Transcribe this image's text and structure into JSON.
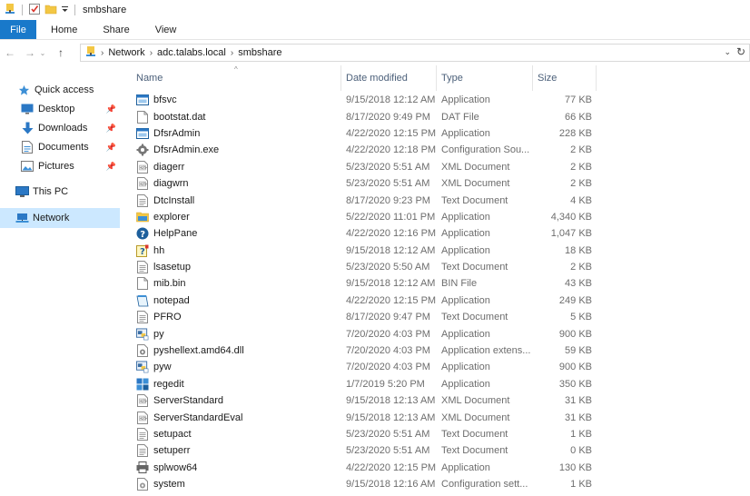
{
  "window": {
    "title": "smbshare"
  },
  "ribbon": {
    "tabs": [
      "File",
      "Home",
      "Share",
      "View"
    ]
  },
  "address": {
    "crumbs": [
      "Network",
      "adc.talabs.local",
      "smbshare"
    ]
  },
  "nav": {
    "quick_access": "Quick access",
    "desktop": "Desktop",
    "downloads": "Downloads",
    "documents": "Documents",
    "pictures": "Pictures",
    "this_pc": "This PC",
    "network": "Network"
  },
  "columns": {
    "name": "Name",
    "date": "Date modified",
    "type": "Type",
    "size": "Size"
  },
  "files": [
    {
      "name": "bfsvc",
      "date": "9/15/2018 12:12 AM",
      "type": "Application",
      "size": "77 KB",
      "icon": "app-window-icon"
    },
    {
      "name": "bootstat.dat",
      "date": "8/17/2020 9:49 PM",
      "type": "DAT File",
      "size": "66 KB",
      "icon": "blank-file-icon"
    },
    {
      "name": "DfsrAdmin",
      "date": "4/22/2020 12:15 PM",
      "type": "Application",
      "size": "228 KB",
      "icon": "app-window-icon"
    },
    {
      "name": "DfsrAdmin.exe",
      "date": "4/22/2020 12:18 PM",
      "type": "Configuration Sou...",
      "size": "2 KB",
      "icon": "config-gear-icon"
    },
    {
      "name": "diagerr",
      "date": "5/23/2020 5:51 AM",
      "type": "XML Document",
      "size": "2 KB",
      "icon": "xml-document-icon"
    },
    {
      "name": "diagwrn",
      "date": "5/23/2020 5:51 AM",
      "type": "XML Document",
      "size": "2 KB",
      "icon": "xml-document-icon"
    },
    {
      "name": "DtcInstall",
      "date": "8/17/2020 9:23 PM",
      "type": "Text Document",
      "size": "4 KB",
      "icon": "text-document-icon"
    },
    {
      "name": "explorer",
      "date": "5/22/2020 11:01 PM",
      "type": "Application",
      "size": "4,340 KB",
      "icon": "folder-app-icon"
    },
    {
      "name": "HelpPane",
      "date": "4/22/2020 12:16 PM",
      "type": "Application",
      "size": "1,047 KB",
      "icon": "help-icon"
    },
    {
      "name": "hh",
      "date": "9/15/2018 12:12 AM",
      "type": "Application",
      "size": "18 KB",
      "icon": "help-file-icon"
    },
    {
      "name": "lsasetup",
      "date": "5/23/2020 5:50 AM",
      "type": "Text Document",
      "size": "2 KB",
      "icon": "text-document-icon"
    },
    {
      "name": "mib.bin",
      "date": "9/15/2018 12:12 AM",
      "type": "BIN File",
      "size": "43 KB",
      "icon": "blank-file-icon"
    },
    {
      "name": "notepad",
      "date": "4/22/2020 12:15 PM",
      "type": "Application",
      "size": "249 KB",
      "icon": "notepad-icon"
    },
    {
      "name": "PFRO",
      "date": "8/17/2020 9:47 PM",
      "type": "Text Document",
      "size": "5 KB",
      "icon": "text-document-icon"
    },
    {
      "name": "py",
      "date": "7/20/2020 4:03 PM",
      "type": "Application",
      "size": "900 KB",
      "icon": "python-launcher-icon"
    },
    {
      "name": "pyshellext.amd64.dll",
      "date": "7/20/2020 4:03 PM",
      "type": "Application extens...",
      "size": "59 KB",
      "icon": "dll-gear-icon"
    },
    {
      "name": "pyw",
      "date": "7/20/2020 4:03 PM",
      "type": "Application",
      "size": "900 KB",
      "icon": "python-launcher-icon"
    },
    {
      "name": "regedit",
      "date": "1/7/2019 5:20 PM",
      "type": "Application",
      "size": "350 KB",
      "icon": "registry-editor-icon"
    },
    {
      "name": "ServerStandard",
      "date": "9/15/2018 12:13 AM",
      "type": "XML Document",
      "size": "31 KB",
      "icon": "xml-document-icon"
    },
    {
      "name": "ServerStandardEval",
      "date": "9/15/2018 12:13 AM",
      "type": "XML Document",
      "size": "31 KB",
      "icon": "xml-document-icon"
    },
    {
      "name": "setupact",
      "date": "5/23/2020 5:51 AM",
      "type": "Text Document",
      "size": "1 KB",
      "icon": "text-document-icon"
    },
    {
      "name": "setuperr",
      "date": "5/23/2020 5:51 AM",
      "type": "Text Document",
      "size": "0 KB",
      "icon": "text-document-icon"
    },
    {
      "name": "splwow64",
      "date": "4/22/2020 12:15 PM",
      "type": "Application",
      "size": "130 KB",
      "icon": "printer-icon"
    },
    {
      "name": "system",
      "date": "9/15/2018 12:16 AM",
      "type": "Configuration sett...",
      "size": "1 KB",
      "icon": "config-settings-icon"
    }
  ]
}
